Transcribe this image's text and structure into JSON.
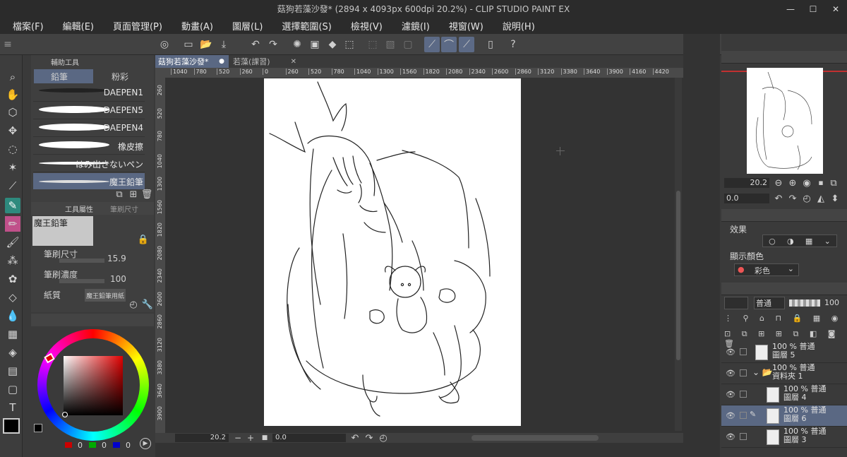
{
  "window": {
    "title": "菇狗若藻沙發* (2894 x 4093px 600dpi 20.2%)  - CLIP STUDIO PAINT EX",
    "minimize": "—",
    "maximize": "☐",
    "close": "✕"
  },
  "menu": [
    "檔案(F)",
    "編輯(E)",
    "頁面管理(P)",
    "動畫(A)",
    "圖層(L)",
    "選擇範圍(S)",
    "檢視(V)",
    "濾鏡(I)",
    "視窗(W)",
    "說明(H)"
  ],
  "subtool": {
    "title": "輔助工具",
    "tabs": [
      "鉛筆",
      "粉彩"
    ],
    "brushes": [
      "DAEPEN1",
      "DAEPEN5",
      "DAEPEN4",
      "橡皮擦",
      "はみ出さないペン",
      "魔王鉛筆"
    ],
    "selected_brush_index": 5
  },
  "tool_property": {
    "tabs": [
      "工具屬性",
      "筆刷尺寸"
    ],
    "preset_name": "魔王鉛筆",
    "brush_size_label": "筆刷尺寸",
    "brush_size_value": "15.9",
    "brush_density_label": "筆刷濃度",
    "brush_density_value": "100",
    "paper_label": "紙質",
    "paper_value": "魔王鉛筆用紙"
  },
  "color": {
    "main_color": "#000000",
    "sub_color": "#ffffff",
    "rgb": [
      "0",
      "0",
      "0"
    ]
  },
  "document": {
    "tabs": [
      "菇狗若藻沙發*",
      "若藻(課習)"
    ],
    "ruler_h": [
      "1040",
      "780",
      "520",
      "260",
      "0",
      "260",
      "520",
      "780",
      "1040",
      "1300",
      "1560",
      "1820",
      "2080",
      "2340",
      "2600",
      "2860",
      "3120",
      "3380",
      "3640",
      "3900",
      "4160",
      "4420"
    ],
    "ruler_v": [
      "260",
      "520",
      "780",
      "1040",
      "1300",
      "1560",
      "1820",
      "2080",
      "2340",
      "2600",
      "2860",
      "3120",
      "3380",
      "3640",
      "3900"
    ],
    "zoom": "20.2",
    "rotation": "0.0"
  },
  "navigator": {
    "zoom": "20.2",
    "rotation": "0.0"
  },
  "sub_view": {
    "effect_label": "效果",
    "display_color_label": "顯示顏色",
    "display_color_value": "彩色"
  },
  "layers_panel": {
    "blend_mode": "普通",
    "opacity": "100",
    "layers": [
      {
        "line1": "100 % 普通",
        "line2": "圖層 5",
        "indent": 0,
        "folder": false,
        "selected": false
      },
      {
        "line1": "100 % 普通",
        "line2": "資料夾 1",
        "indent": 0,
        "folder": true,
        "selected": false
      },
      {
        "line1": "100 % 普通",
        "line2": "圖層 4",
        "indent": 1,
        "folder": false,
        "selected": false
      },
      {
        "line1": "100 % 普通",
        "line2": "圖層 6",
        "indent": 1,
        "folder": false,
        "selected": true
      },
      {
        "line1": "100 % 普通",
        "line2": "圖層 3",
        "indent": 1,
        "folder": false,
        "selected": false
      }
    ]
  }
}
